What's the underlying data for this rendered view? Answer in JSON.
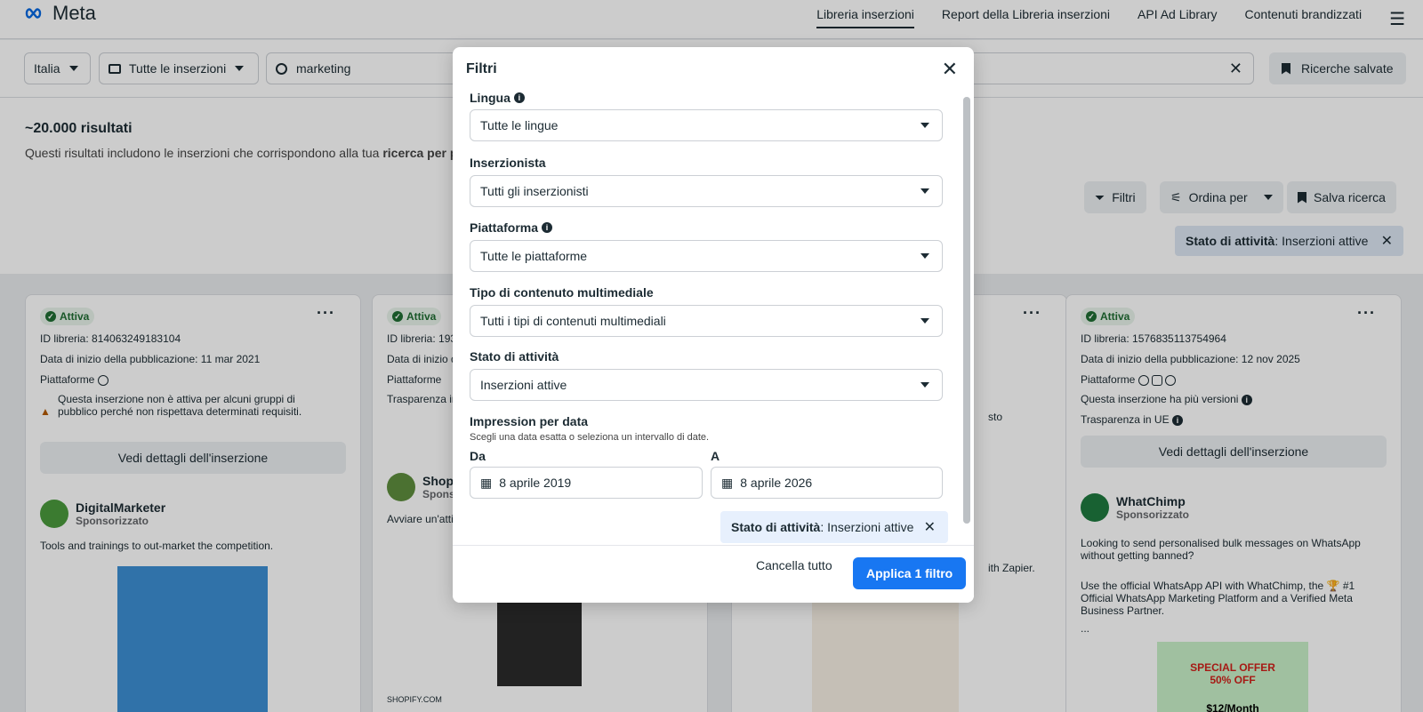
{
  "header": {
    "logo": "Meta",
    "nav": [
      "Libreria inserzioni",
      "Report della Libreria inserzioni",
      "API Ad Library",
      "Contenuti brandizzati"
    ]
  },
  "search": {
    "country": "Italia",
    "type": "Tutte le inserzioni",
    "query": "marketing",
    "saved": "Ricerche salvate"
  },
  "results": {
    "count": "~20.000 risultati",
    "sub": "Questi risultati includono le inserzioni che corrispondono alla tua ",
    "sub_bold": "ricerca per pa"
  },
  "actions": {
    "filters": "Filtri",
    "sort": "Ordina per",
    "save": "Salva ricerca",
    "badge_label": "Stato di attività",
    "badge_value": ": Inserzioni attive"
  },
  "cards": [
    {
      "status": "Attiva",
      "id": "ID libreria: 814063249183104",
      "start": "Data di inizio della pubblicazione: 11 mar 2021",
      "platforms": "Piattaforme",
      "warning": "Questa inserzione non è attiva per alcuni gruppi di pubblico perché non rispettava determinati requisiti.",
      "details": "Vedi dettagli dell'inserzione",
      "advertiser": "DigitalMarketer",
      "sponsored": "Sponsorizzato",
      "text": "Tools and trainings to out-market the competition."
    },
    {
      "status": "Attiva",
      "id": "ID libreria: 193",
      "start": "Data di inizio d",
      "platforms": "Piattaforme",
      "transp": "Trasparenza in",
      "advertiser": "Shopi",
      "sponsored": "Sponso",
      "text": "Avviare un'atti",
      "domain": "SHOPIFY.COM"
    },
    {
      "tail": "sto",
      "text": "ith Zapier."
    },
    {
      "status": "Attiva",
      "id": "ID libreria: 1576835113754964",
      "start": "Data di inizio della pubblicazione: 12 nov 2025",
      "platforms": "Piattaforme",
      "versions": "Questa inserzione ha più versioni",
      "transp": "Trasparenza in UE",
      "details": "Vedi dettagli dell'inserzione",
      "advertiser": "WhatChimp",
      "sponsored": "Sponsorizzato",
      "text1": "Looking to send personalised bulk messages on WhatsApp without getting banned?",
      "text2": "Use the official WhatsApp API with WhatChimp, the 🏆 #1 Official WhatsApp Marketing Platform and a Verified Meta Business Partner.",
      "ellipsis": "...",
      "offer": "SPECIAL OFFER",
      "off": "50% OFF",
      "price": "$12/Month"
    }
  ],
  "modal": {
    "title": "Filtri",
    "language": {
      "label": "Lingua",
      "value": "Tutte le lingue"
    },
    "advertiser": {
      "label": "Inserzionista",
      "value": "Tutti gli inserzionisti"
    },
    "platform": {
      "label": "Piattaforma",
      "value": "Tutte le piattaforme"
    },
    "media": {
      "label": "Tipo di contenuto multimediale",
      "value": "Tutti i tipi di contenuti multimediali"
    },
    "activity": {
      "label": "Stato di attività",
      "value": "Inserzioni attive"
    },
    "impressions": {
      "label": "Impression per data",
      "hint": "Scegli una data esatta o seleziona un intervallo di date.",
      "from_label": "Da",
      "to_label": "A",
      "from": "8 aprile 2019",
      "to": "8 aprile 2026"
    },
    "chip": {
      "label": "Stato di attività",
      "value": ": Inserzioni attive"
    },
    "cancel": "Cancella tutto",
    "apply": "Applica 1 filtro"
  }
}
